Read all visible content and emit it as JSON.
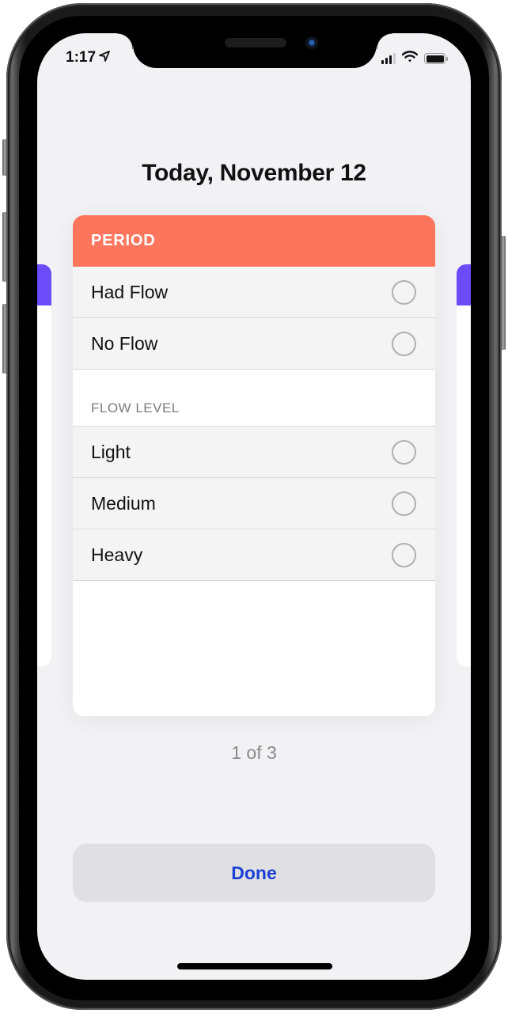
{
  "status_bar": {
    "time": "1:17",
    "location_icon": "location-arrow-icon",
    "signal_icon": "cellular-signal-icon",
    "wifi_icon": "wifi-icon",
    "battery_icon": "battery-icon"
  },
  "header": {
    "title": "Today, November 12"
  },
  "card": {
    "title": "PERIOD",
    "accent_color": "#fd755c",
    "flow_options": [
      {
        "label": "Had Flow",
        "selected": false
      },
      {
        "label": "No Flow",
        "selected": false
      }
    ],
    "flow_level_header": "FLOW LEVEL",
    "flow_levels": [
      {
        "label": "Light",
        "selected": false
      },
      {
        "label": "Medium",
        "selected": false
      },
      {
        "label": "Heavy",
        "selected": false
      }
    ]
  },
  "adjacent_card_accent": "#6b4bfa",
  "pager": {
    "text": "1 of 3",
    "current": 1,
    "total": 3
  },
  "done_button": {
    "label": "Done",
    "color": "#1a3fd4"
  }
}
